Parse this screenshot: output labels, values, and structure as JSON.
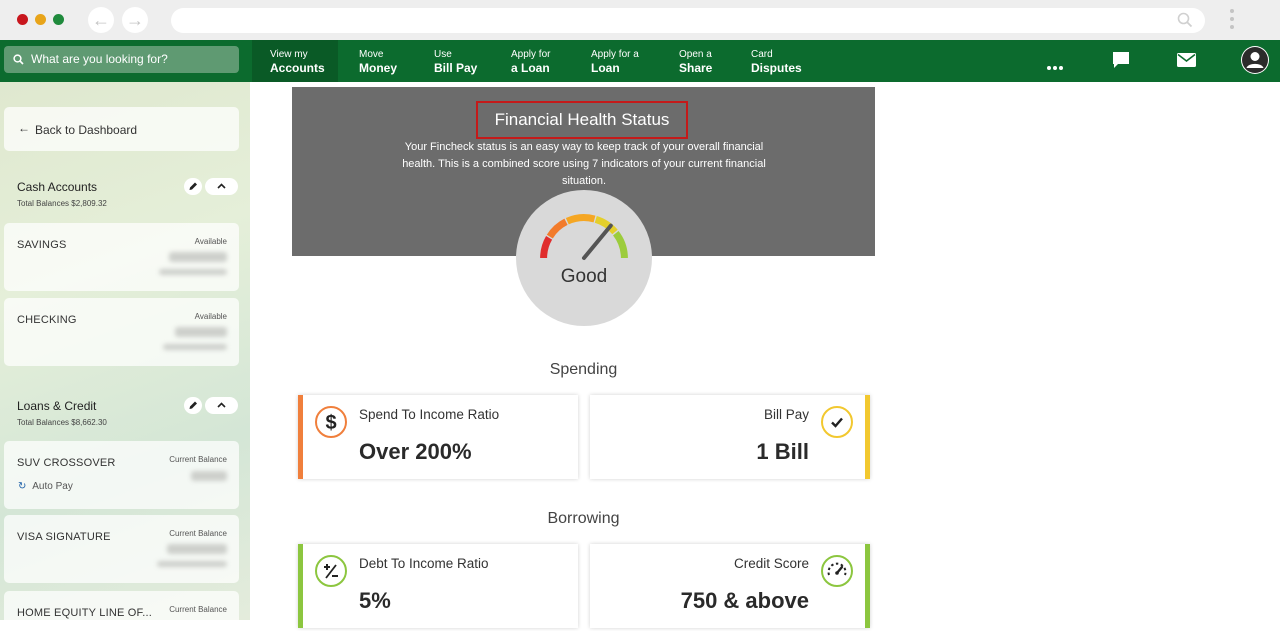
{
  "browser": {
    "back_glyph": "←",
    "forward_glyph": "→",
    "url": ""
  },
  "topnav": {
    "search_placeholder": "What are you looking for?",
    "items": [
      {
        "line1": "View my",
        "line2": "Accounts"
      },
      {
        "line1": "Move",
        "line2": "Money"
      },
      {
        "line1": "Use",
        "line2": "Bill Pay"
      },
      {
        "line1": "Apply for",
        "line2": "a Loan"
      },
      {
        "line1": "Apply for a",
        "line2": "Loan"
      },
      {
        "line1": "Open a",
        "line2": "Share"
      },
      {
        "line1": "Card",
        "line2": "Disputes"
      }
    ],
    "icons": [
      "more-icon",
      "chat-icon",
      "mail-icon",
      "user-icon"
    ]
  },
  "sidebar": {
    "back_label": "Back to Dashboard",
    "cash": {
      "title": "Cash Accounts",
      "subtitle": "Total Balances $2,809.32",
      "accounts": [
        {
          "name": "SAVINGS",
          "balance_label": "Available"
        },
        {
          "name": "CHECKING",
          "balance_label": "Available"
        }
      ]
    },
    "loans": {
      "title": "Loans & Credit",
      "subtitle": "Total Balances $8,662.30",
      "accounts": [
        {
          "name": "SUV CROSSOVER",
          "balance_label": "Current Balance",
          "autopay": "Auto Pay"
        },
        {
          "name": "VISA SIGNATURE",
          "balance_label": "Current Balance"
        },
        {
          "name": "HOME EQUITY LINE OF...",
          "balance_label": "Current Balance"
        }
      ]
    }
  },
  "main": {
    "title": "Financial Health Status",
    "description": "Your Fincheck status is an easy way to keep track of your overall financial health. This is a combined score using 7 indicators of your current financial situation.",
    "gauge": {
      "label": "Good",
      "level": 0.72
    },
    "spending": {
      "heading": "Spending",
      "left": {
        "label": "Spend To Income Ratio",
        "value": "Over 200%",
        "icon": "dollar-icon",
        "color": "#f07f3c"
      },
      "right": {
        "label": "Bill Pay",
        "value": "1 Bill",
        "icon": "check-icon",
        "color": "#f2c82f"
      }
    },
    "borrowing": {
      "heading": "Borrowing",
      "left": {
        "label": "Debt To Income Ratio",
        "value": "5%",
        "icon": "plus-minus-icon",
        "color": "#8cc63f"
      },
      "right": {
        "label": "Credit Score",
        "value": "750 & above",
        "icon": "speedometer-icon",
        "color": "#8cc63f"
      }
    }
  },
  "colors": {
    "brand_green": "#0c6b2e",
    "hero_gray": "#6c6c6c",
    "highlight_red": "#c41a1a"
  }
}
